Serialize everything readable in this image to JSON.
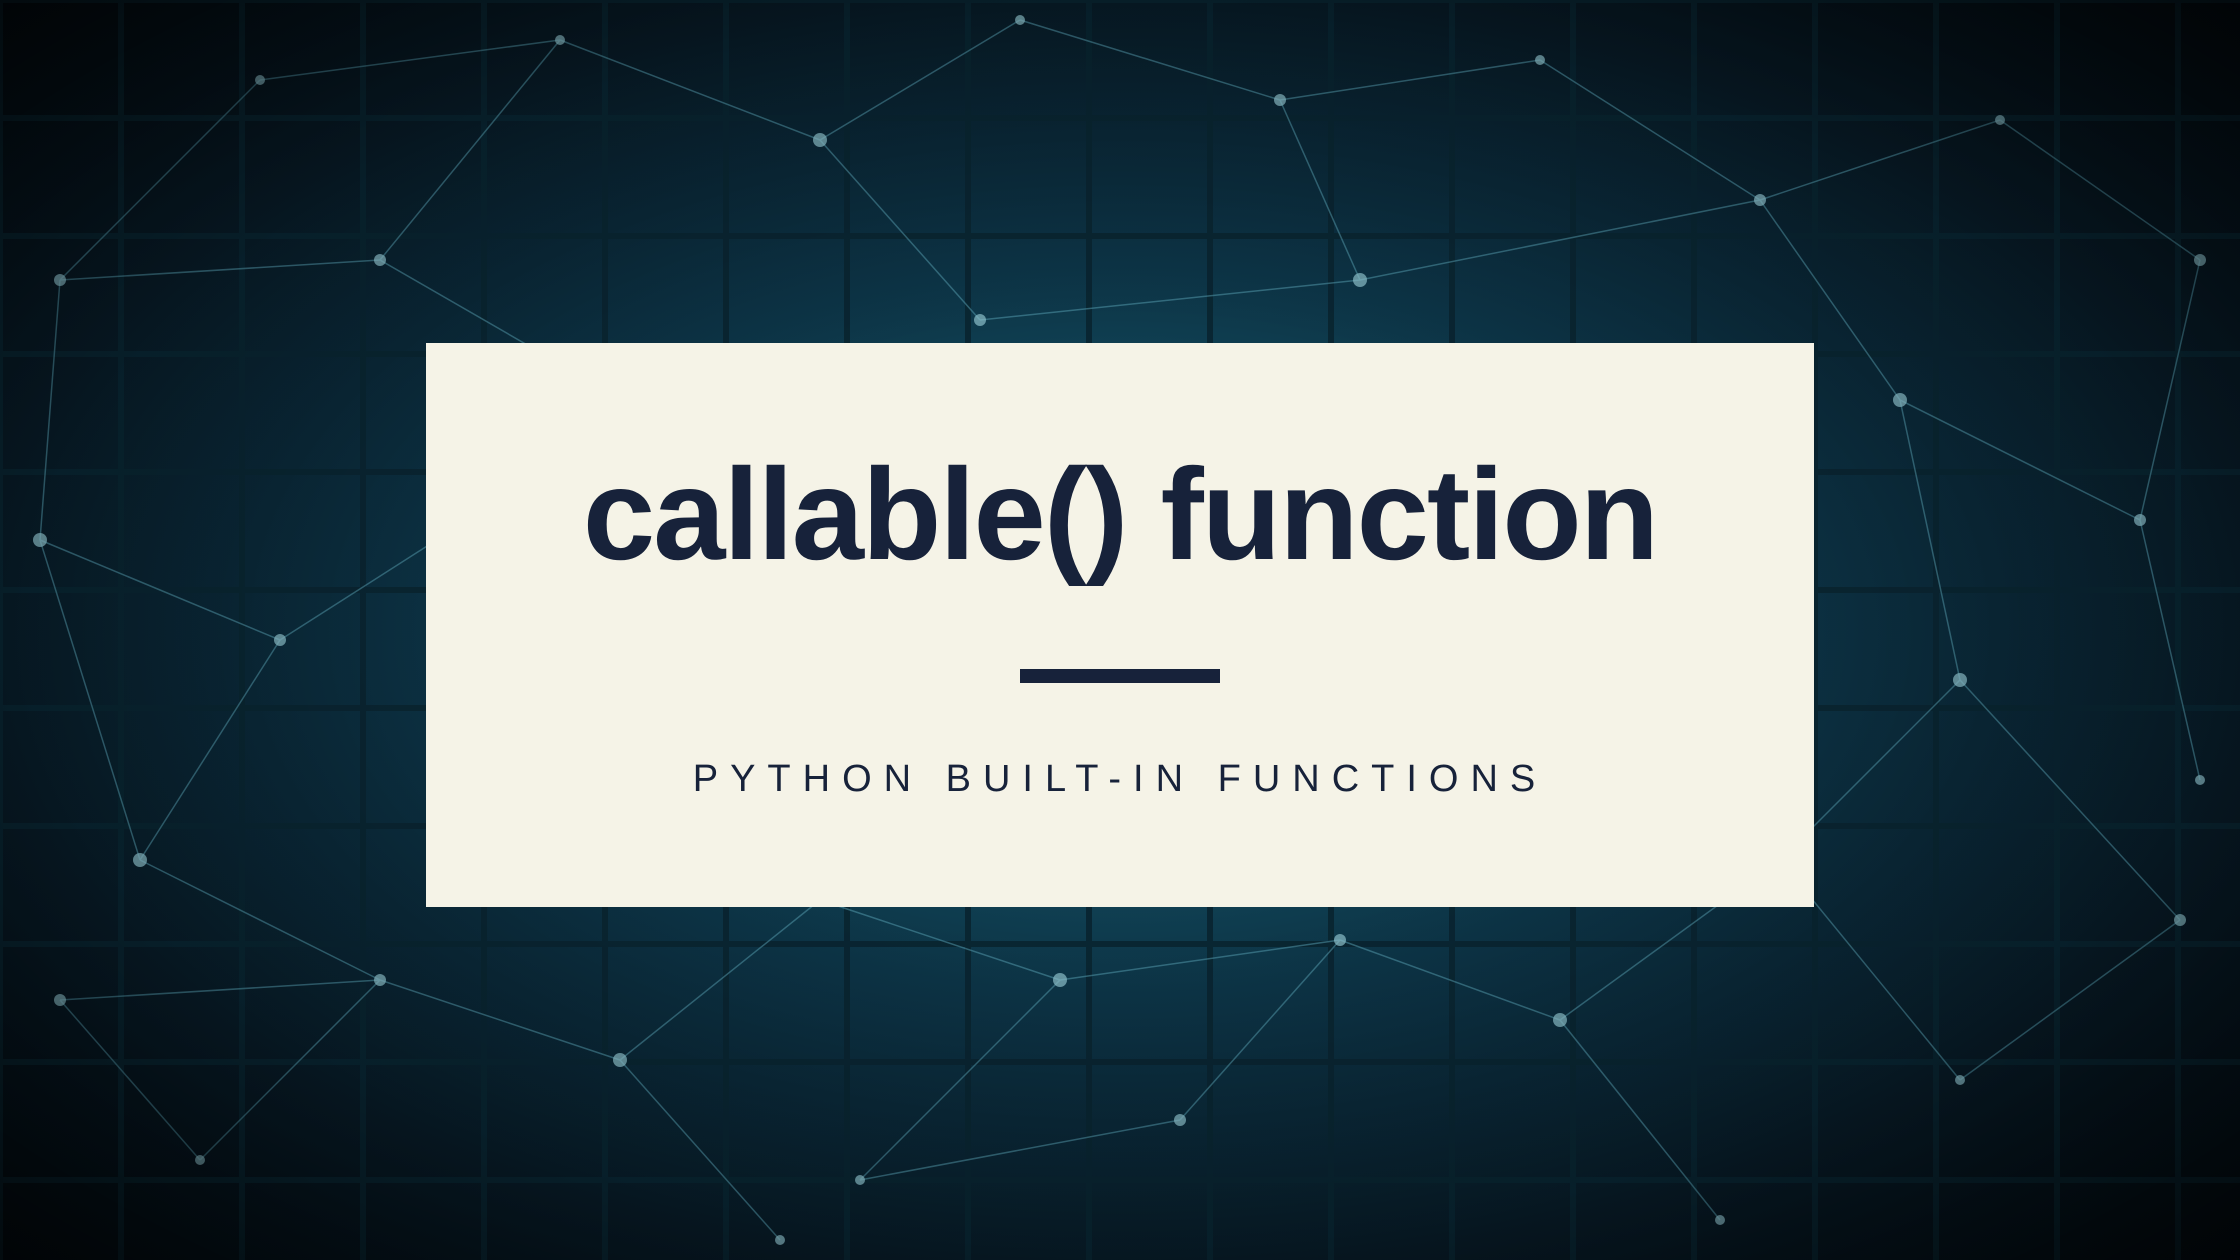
{
  "card": {
    "title": "callable() function",
    "subtitle": "PYTHON BUILT-IN FUNCTIONS"
  },
  "colors": {
    "card_bg": "#f5f3e7",
    "text": "#17223a",
    "bg_center": "#1a6b82",
    "bg_edge": "#040e16"
  }
}
